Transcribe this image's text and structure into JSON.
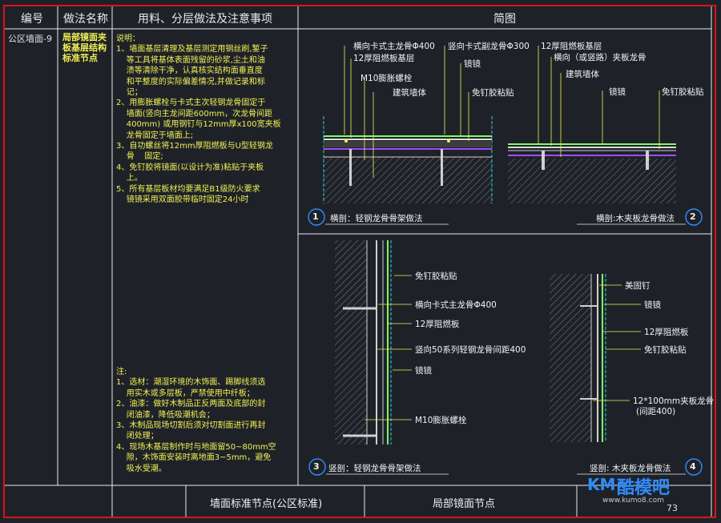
{
  "header": {
    "code": "编号",
    "method_name": "做法名称",
    "materials": "用料、分层做法及注意事项",
    "sketch": "简图"
  },
  "row": {
    "code": "公区墙面-9",
    "name": "局部镜面夹板基层结构标准节点"
  },
  "notes_a": {
    "lines": [
      "说明：",
      "1、墙面基层清理及基层测定用钢丝刷,錾子",
      "    等工具将基体表面残留的砂浆,尘土和油",
      "    渍等清除干净，认真核实结构面垂直度",
      "    和平整度的实际偏差情况,并做记录和标",
      "    记；",
      "2、用膨胀螺栓与卡式主次轻钢龙骨固定于",
      "    墙面(竖向主龙间距600mm，次龙骨间距",
      "    400mm) 或用钢钉与12mm厚x100宽夹板",
      "    龙骨固定于墙面上;",
      "3、自功螺丝将12mm厚阻燃板与U型轻钢龙",
      "    骨    固定;",
      "4、免钉胶将镜面(以设计为准)粘贴于夹板",
      "    上。",
      "5、所有基层板材均要满足B1级防火要求",
      "    镜镜采用双面胶带临时固定24小时"
    ]
  },
  "notes_b": {
    "lines": [
      "注:",
      "1、选材：潮湿环境的木饰面、踢脚线须选",
      "    用实木或多层板，严禁使用中纤板；",
      "2、油漆：做好木制品正反两面及底部的封",
      "    闭油漆，降低吸潮机会；",
      "3、木制品现场切割后须对切割面进行再封",
      "    闭处理；",
      "4、现场木基层制作时与地面留50~80mm空",
      "    隙，木饰面安装时离地面3~5mm，避免",
      "    吸水受潮。"
    ]
  },
  "d1": {
    "number": "1",
    "title": "横剖：轻钢龙骨骨架做法",
    "l1": "横向卡式主龙骨Φ400",
    "l2": "12厚阻燃板基层",
    "l3": "竖向卡式副龙骨Φ300",
    "l4": "镜镜",
    "l5": "M10膨胀螺栓",
    "l6": "建筑墙体",
    "l7": "免钉胶粘贴"
  },
  "d2": {
    "number": "2",
    "title": "横剖:木夹板龙骨做法",
    "l1": "12厚阻燃板基层",
    "l2": "横向（或竖路）夹板龙骨",
    "l3": "建筑墙体",
    "l4": "镜镜",
    "l5": "免钉胶粘贴"
  },
  "d3": {
    "number": "3",
    "title": "竖剖：轻钢龙骨骨架做法",
    "l1": "免钉胶粘贴",
    "l2": "横向卡式主龙骨Φ400",
    "l3": "12厚阻燃板",
    "l4": "竖向50系列轻钢龙骨间距400",
    "l5": "镜镜",
    "l6": "M10膨胀螺栓"
  },
  "d4": {
    "number": "4",
    "title": "竖剖: 木夹板龙骨做法",
    "l1": "美固钉",
    "l2": "镜镜",
    "l3": "12厚阻燃板",
    "l4": "免钉胶粘贴",
    "l5": "12*100mm夹板龙骨",
    "l6": "(间距400)"
  },
  "footer": {
    "left": "墙面标准节点(公区标准)",
    "right": "局部镜面节点",
    "brand": "酷模吧",
    "brand_prefix": "KM",
    "url": "www.kumo8.com",
    "page": "73"
  }
}
